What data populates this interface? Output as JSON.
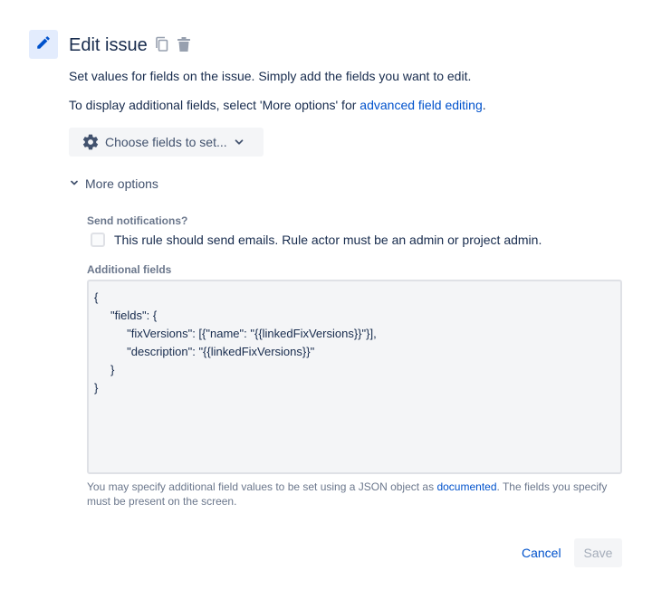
{
  "header": {
    "title": "Edit issue",
    "icons": [
      "pencil-icon",
      "copy-icon",
      "trash-icon"
    ]
  },
  "intro": {
    "line1": "Set values for fields on the issue. Simply add the fields you want to edit.",
    "line2_prefix": "To display additional fields, select 'More options' for ",
    "line2_link": "advanced field editing",
    "line2_suffix": "."
  },
  "choose_fields": {
    "label": "Choose fields to set...",
    "icons": [
      "gear-icon",
      "chevron-down-icon"
    ]
  },
  "more_options": {
    "label": "More options",
    "expanded": true
  },
  "notifications": {
    "label": "Send notifications?",
    "checkbox_label": "This rule should send emails. Rule actor must be an admin or project admin.",
    "checked": false
  },
  "additional_fields": {
    "label": "Additional fields",
    "value": "{\n     \"fields\": {\n          \"fixVersions\": [{\"name\": \"{{linkedFixVersions}}\"}],\n          \"description\": \"{{linkedFixVersions}}\"\n     }\n}",
    "help_prefix": "You may specify additional field values to be set using a JSON object as ",
    "help_link": "documented",
    "help_suffix": ". The fields you specify must be present on the screen."
  },
  "footer": {
    "cancel_label": "Cancel",
    "save_label": "Save"
  },
  "colors": {
    "link": "#0052cc",
    "text": "#172b4d",
    "subtle": "#6b778c",
    "icon_box": "#e3ecfd",
    "button_bg": "#f4f5f7"
  }
}
